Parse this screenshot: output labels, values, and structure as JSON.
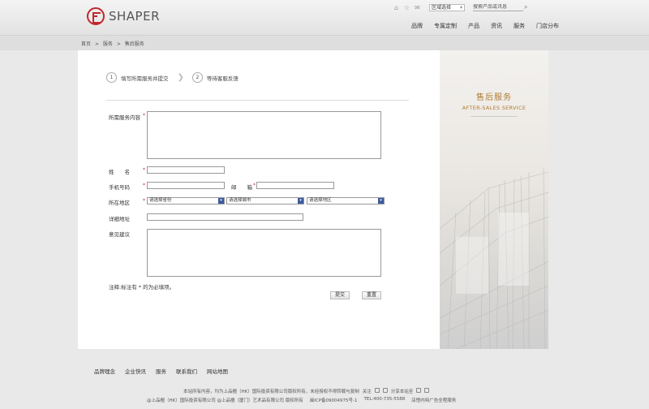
{
  "header": {
    "logo_text": "SHAPER",
    "region_select": "区域选择",
    "search_placeholder": "搜索产品或讯息",
    "nav": [
      "品牌",
      "专属定制",
      "产品",
      "资讯",
      "服务",
      "门店分布"
    ]
  },
  "breadcrumb": [
    "首页",
    ">",
    "服务",
    ">",
    "售后服务"
  ],
  "steps": [
    {
      "num": "1",
      "label": "填写所需服务并提交"
    },
    {
      "num": "2",
      "label": "等待客服反馈"
    }
  ],
  "form": {
    "service_label": "所需服务内容",
    "name_label": "姓　　名",
    "phone_label": "手机号码",
    "email_label": "邮　　箱",
    "region_label": "所在地区",
    "province_default": "请选择省份",
    "city_default": "请选择城市",
    "district_default": "请选择地区",
    "address_label": "详细地址",
    "feedback_label": "意见建议",
    "required_mark": "*",
    "note": "注释:标注有 * 的为必填项。",
    "submit": "提交",
    "reset": "重置"
  },
  "side": {
    "title": "售后服务",
    "subtitle": "AFTER-SALES SERVICE"
  },
  "footer": {
    "links": [
      "品牌理念",
      "企业快讯",
      "服务",
      "联系我们",
      "网站地图"
    ],
    "copyright": "本站所有内容，均为上品檀（HK）国际投资有限公司版权所有，未经授权不得转载与复制",
    "follow": "关注",
    "share": "分享本站至",
    "line2": [
      "@上品檀（HK）国际投资有限公司 @上品檀（厦门）艺术品有限公司 版权所有",
      "闽ICP备09004975号-1",
      "TEL:400-735-5588",
      "店悟内特广告全程服务"
    ]
  }
}
